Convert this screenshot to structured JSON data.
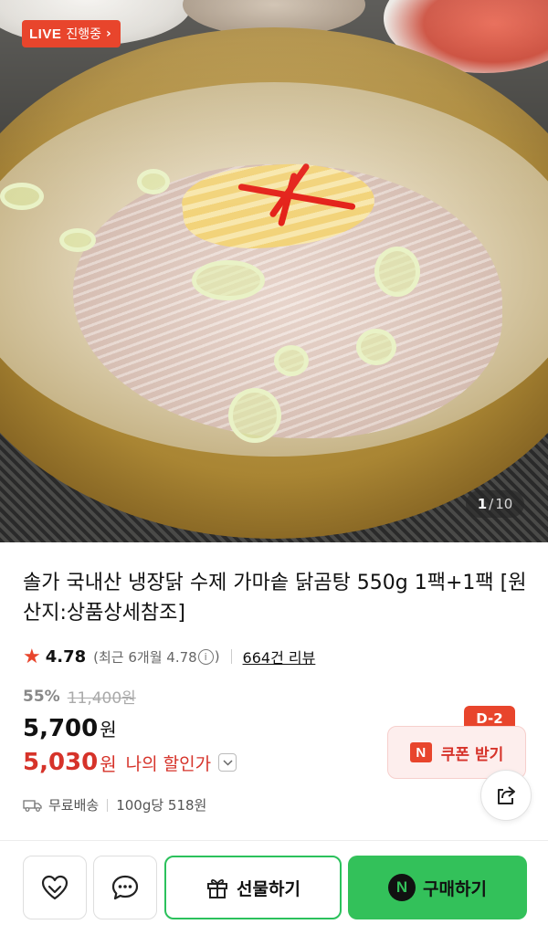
{
  "live_badge": {
    "label": "LIVE",
    "status": "진행중",
    "chevron": "›"
  },
  "gallery": {
    "current": "1",
    "separator": "/",
    "total": "10"
  },
  "product": {
    "title": "솔가 국내산 냉장닭 수제 가마솥 닭곰탕 550g 1팩+1팩 [원산지:상품상세참조]"
  },
  "rating": {
    "score": "4.78",
    "recent_prefix": "(최근 6개월 4.78",
    "info_glyph": "i",
    "recent_suffix": ")",
    "review_count": "664건 리뷰"
  },
  "pricing": {
    "discount_rate": "55%",
    "original_price": "11,400원",
    "sale_price": "5,700",
    "sale_unit": "원",
    "my_price": "5,030",
    "my_unit": "원",
    "my_price_label": "나의 할인가"
  },
  "shipping": {
    "delivery": "무료배송",
    "unit_price": "100g당 518원"
  },
  "coupon": {
    "dday": "D-2",
    "label": "쿠폰 받기",
    "logo": "N"
  },
  "actions": {
    "gift_label": "선물하기",
    "buy_label": "구매하기",
    "buy_logo": "N"
  },
  "icons": {
    "live_chevron": "chevron-right-icon",
    "info": "info-icon",
    "dropdown": "chevron-down-icon",
    "truck": "truck-icon",
    "share": "share-icon",
    "wish": "heart-icon",
    "talk": "chat-icon",
    "gift": "gift-icon",
    "star": "star-icon"
  },
  "colors": {
    "accent_red": "#e8452c",
    "price_red": "#d6332a",
    "naver_green": "#33c15a"
  }
}
